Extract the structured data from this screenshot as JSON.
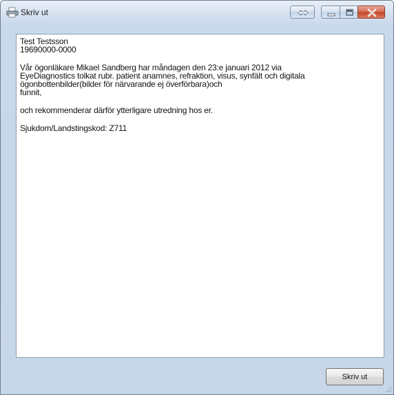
{
  "window": {
    "title": "Skriv ut",
    "icon": "printer-icon",
    "caption_buttons": [
      "swap-icon",
      "minimize-icon",
      "maximize-icon",
      "close-icon"
    ]
  },
  "document": {
    "lines": [
      "Test Testsson",
      "19690000-0000",
      "",
      "Vår ögonläkare Mikael Sandberg har måndagen den 23:e januari 2012 via",
      "EyeDiagnostics tolkat rubr. patient anamnes, refraktion, visus, synfält och digitala",
      "ögonbottenbilder(bilder för närvarande ej överförbara)och",
      "funnit,",
      "",
      "och rekommenderar därför ytterligare utredning hos er.",
      "",
      "Sjukdom/Landstingskod: Z711"
    ]
  },
  "footer": {
    "print_label": "Skriv ut"
  },
  "colors": {
    "frame": "#c7d6e8",
    "close_button": "#c5432b",
    "text": "#111111"
  }
}
